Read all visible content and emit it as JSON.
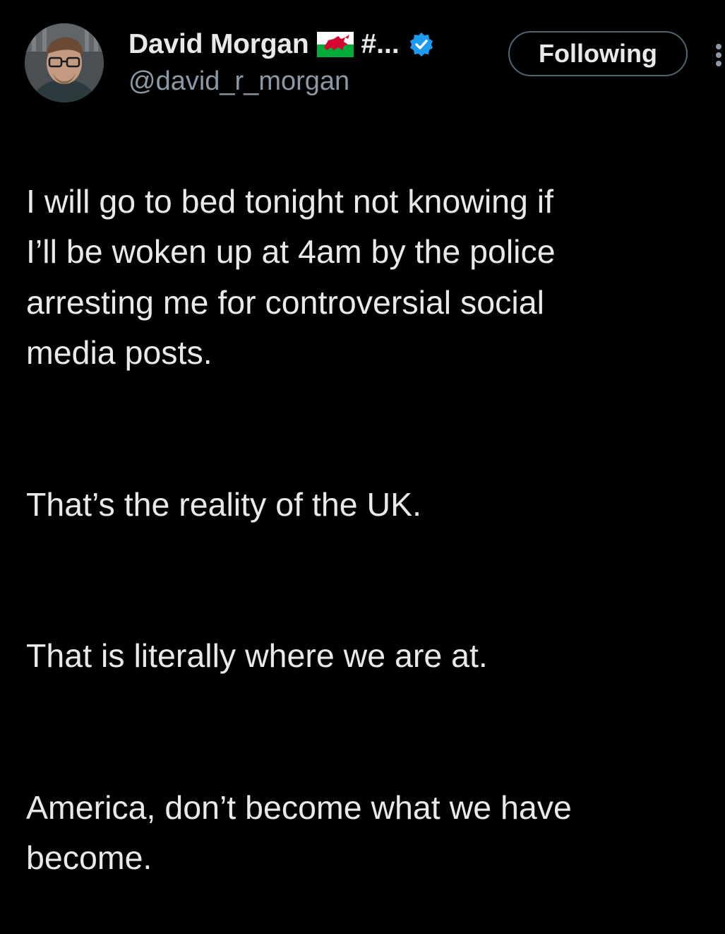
{
  "tweet": {
    "author": {
      "display_name": "David Morgan",
      "name_suffix": "#...",
      "handle": "@david_r_morgan",
      "flag_icon": "wales-flag-icon",
      "verified_icon": "verified-badge-icon",
      "verified_color": "#1d9bf0"
    },
    "follow_button_label": "Following",
    "more_icon": "more-options-icon",
    "paragraphs": [
      "I will go to bed tonight not knowing if\nI’ll be woken up at 4am by the police\narresting me for controversial social\nmedia posts.",
      "That’s the reality of the UK.",
      "That is literally where we are at.",
      "America, don’t become what we have\nbecome."
    ]
  },
  "colors": {
    "background": "#000000",
    "text_primary": "#e7e9ea",
    "text_secondary": "#8b98a5",
    "button_border": "#536471"
  }
}
